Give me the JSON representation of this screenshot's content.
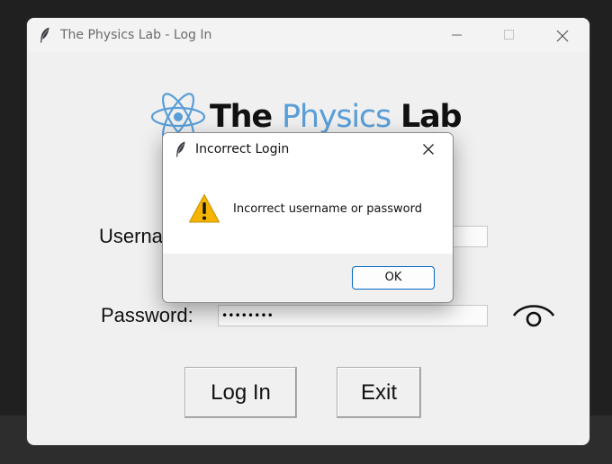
{
  "main_window": {
    "title": "The Physics Lab - Log In",
    "logo": {
      "word_the": "The",
      "word_physics": "Physics",
      "word_lab": "Lab",
      "accent_color": "#5a9ed8"
    },
    "form": {
      "username_label": "Username:",
      "username_value": "",
      "password_label": "Password:",
      "password_value": "••••••••"
    },
    "buttons": {
      "login": "Log In",
      "exit": "Exit"
    },
    "icons": {
      "app": "feather-icon",
      "show_password": "eye-icon",
      "minimize": "minimize-icon",
      "maximize": "maximize-icon",
      "close": "close-icon"
    }
  },
  "dialog": {
    "title": "Incorrect Login",
    "message": "Incorrect username or password",
    "ok_label": "OK",
    "icons": {
      "warning": "warning-icon",
      "app": "feather-icon",
      "close": "close-icon"
    },
    "focus_color": "#0067c0",
    "warning_color": "#f4b400"
  }
}
